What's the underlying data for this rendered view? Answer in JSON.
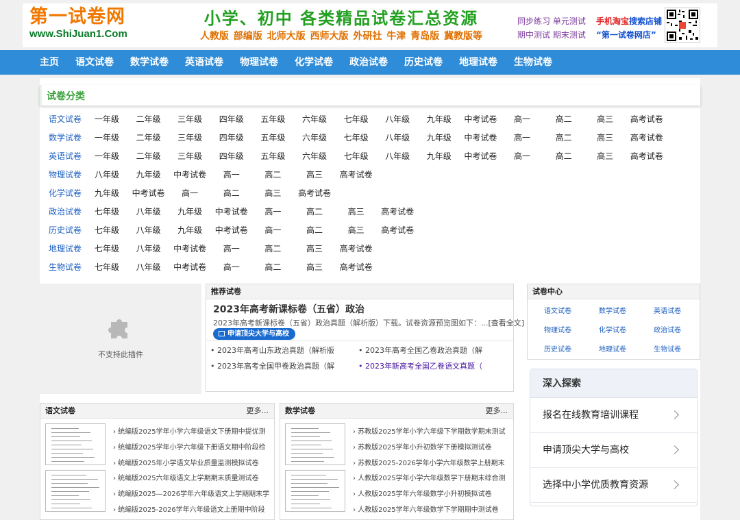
{
  "header": {
    "logo_main": "第一试卷网",
    "logo_url": "www.ShiJuan1.Com",
    "slogan_main": "小学、初中 各类精品试卷汇总资源",
    "slogan_sub": "人教版 部编版 北师大版 西师大版 外研社 牛津 青岛版  冀教版等",
    "right_col1_line1": "同步练习 单元测试",
    "right_col1_line2": "期中测试 期末测试",
    "right_col2_line1_a": "手机淘宝",
    "right_col2_line1_b": "搜索店铺",
    "right_col2_line2": "“第一试卷网店”"
  },
  "nav": [
    "主页",
    "语文试卷",
    "数学试卷",
    "英语试卷",
    "物理试卷",
    "化学试卷",
    "政治试卷",
    "历史试卷",
    "地理试卷",
    "生物试卷"
  ],
  "category": {
    "title": "试卷分类",
    "rows": [
      {
        "head": "语文试卷",
        "items": [
          "一年级",
          "二年级",
          "三年级",
          "四年级",
          "五年级",
          "六年级",
          "七年级",
          "八年级",
          "九年级",
          "中考试卷",
          "高一",
          "高二",
          "高三",
          "高考试卷"
        ]
      },
      {
        "head": "数学试卷",
        "items": [
          "一年级",
          "二年级",
          "三年级",
          "四年级",
          "五年级",
          "六年级",
          "七年级",
          "八年级",
          "九年级",
          "中考试卷",
          "高一",
          "高二",
          "高三",
          "高考试卷"
        ]
      },
      {
        "head": "英语试卷",
        "items": [
          "一年级",
          "二年级",
          "三年级",
          "四年级",
          "五年级",
          "六年级",
          "七年级",
          "八年级",
          "九年级",
          "中考试卷",
          "高一",
          "高二",
          "高三",
          "高考试卷"
        ]
      },
      {
        "head": "物理试卷",
        "items": [
          "八年级",
          "九年级",
          "中考试卷",
          "高一",
          "高二",
          "高三",
          "高考试卷"
        ]
      },
      {
        "head": "化学试卷",
        "items": [
          "九年级",
          "中考试卷",
          "高一",
          "高二",
          "高三",
          "高考试卷"
        ]
      },
      {
        "head": "政治试卷",
        "items": [
          "七年级",
          "八年级",
          "九年级",
          "中考试卷",
          "高一",
          "高二",
          "高三",
          "高考试卷"
        ]
      },
      {
        "head": "历史试卷",
        "items": [
          "七年级",
          "八年级",
          "九年级",
          "中考试卷",
          "高一",
          "高二",
          "高三",
          "高考试卷"
        ]
      },
      {
        "head": "地理试卷",
        "items": [
          "七年级",
          "八年级",
          "中考试卷",
          "高一",
          "高二",
          "高三",
          "高考试卷"
        ]
      },
      {
        "head": "生物试卷",
        "items": [
          "七年级",
          "八年级",
          "中考试卷",
          "高一",
          "高二",
          "高三",
          "高考试卷"
        ]
      }
    ]
  },
  "plugin": {
    "text": "不支持此插件"
  },
  "recommend": {
    "header": "推荐试卷",
    "title": "2023年高考新课标卷（五省）政治",
    "desc": "2023年高考新课标卷（五省）政治真题（解析版）下载。试卷资源预览图如下：...",
    "view_full": "[查看全文]",
    "button": "申请顶尖大学与高校",
    "list": [
      "2023年高考山东政治真题（解析版",
      "2023年高考全国乙卷政治真题（解",
      "2023年高考全国甲卷政治真题（解",
      "2023年新高考全国乙卷语文真题（"
    ]
  },
  "center": {
    "header": "试卷中心",
    "items": [
      "语文试卷",
      "数学试卷",
      "英语试卷",
      "物理试卷",
      "化学试卷",
      "政治试卷",
      "历史试卷",
      "地理试卷",
      "生物试卷"
    ]
  },
  "explore": {
    "header": "深入探索",
    "items": [
      "报名在线教育培训课程",
      "申请顶尖大学与高校",
      "选择中小学优质教育资源"
    ]
  },
  "yuwen": {
    "header": "语文试卷",
    "more": "更多...",
    "list": [
      "统编版2025学年小学六年级语文下册期中提优测",
      "统编版2025学年小学六年级下册语文期中阶段检",
      "统编版2025年小学语文毕业质量监测模拟试卷",
      "统编版2025六年级语文上学期期末质量测试卷",
      "统编版2025—2026学年六年级语文上学期期末学",
      "统编版2025-2026学年六年级语文上册期中阶段"
    ]
  },
  "shuxue": {
    "header": "数学试卷",
    "more": "更多...",
    "list": [
      "苏教版2025学年小学六年级下学期数学期末测试",
      "苏教版2025学年小升初数学下册模拟测试卷",
      "苏教版2025-2026学年小学六年级数学上册期末",
      "人教版2025学年小学六年级数学下册期末综合测",
      "人教版2025学年六年级数学小升初模拟试卷",
      "人教版2025学年六年级数学下学期期中测试卷"
    ]
  }
}
